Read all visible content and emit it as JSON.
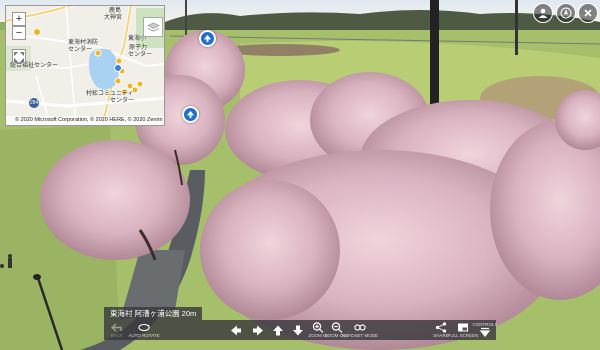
{
  "map": {
    "labels": {
      "town": "鹿島",
      "daimachi": "大神宮",
      "tokai_center": "東海村消防",
      "center": "センター",
      "school": "東海小",
      "go": "原子力",
      "go_center": "センター",
      "soukan": "総合福祉センター",
      "route": "284",
      "plaza": "村松コミュニティ",
      "plaza2": "センター"
    },
    "zoom_in": "+",
    "zoom_out": "−",
    "copyright": "© 2020 Microsoft Corporation, © 2020 HERE, © 2020 Zenrin"
  },
  "caption": "東海村 阿漕ヶ浦公園 20m",
  "toolbar": {
    "back": "BACK",
    "auto_rotate": "AUTO ROTATE",
    "zoom_in": "ZOOM IN",
    "zoom_out": "ZOOM OUT",
    "headset": "HEADSET MODE",
    "share": "SHARE",
    "fullscreen": "FULL SCREEN",
    "controls": "CONTROLS"
  },
  "colors": {
    "accent_blue": "#1f6fd0",
    "toolbar_bg": "#37373c"
  },
  "icons": {
    "top_right": [
      "user-icon",
      "compass-icon",
      "close-icon"
    ],
    "hotspots": [
      "arrow-up-icon",
      "arrow-up-icon"
    ]
  }
}
